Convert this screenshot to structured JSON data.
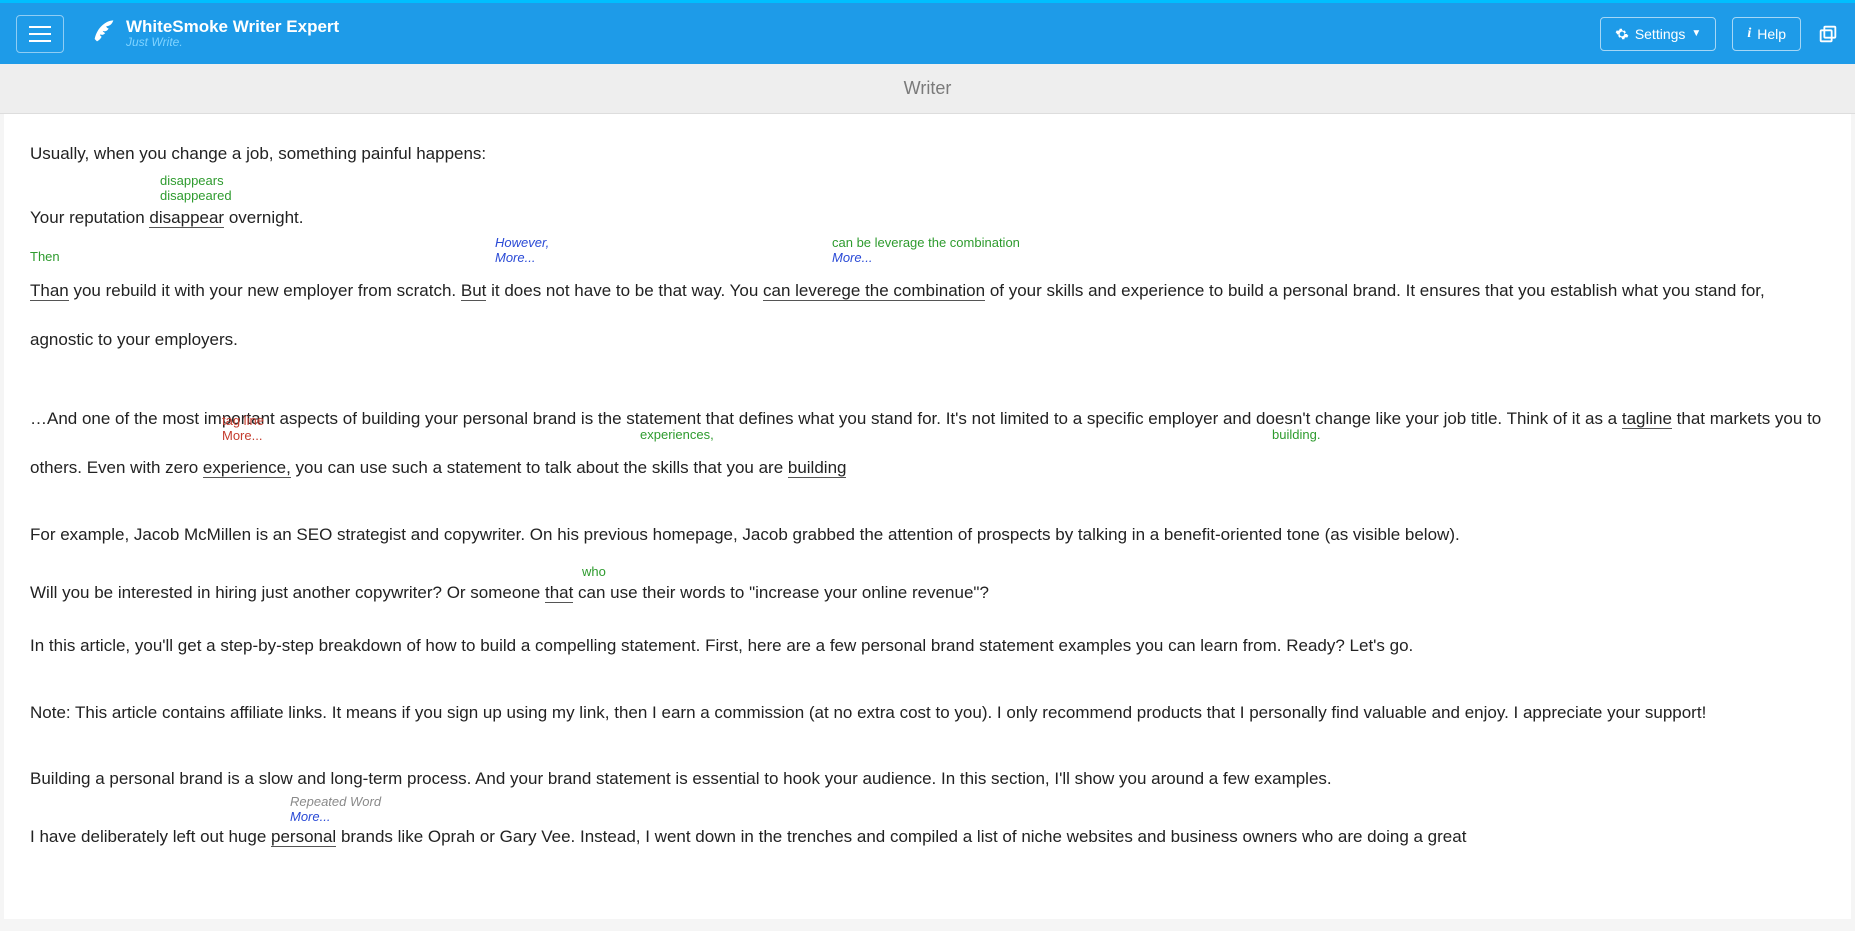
{
  "header": {
    "brand_title": "WhiteSmoke Writer Expert",
    "brand_tagline": "Just Write.",
    "settings_label": "Settings",
    "help_label": "Help"
  },
  "titlebar": {
    "label": "Writer"
  },
  "suggestions": {
    "disappear": {
      "opt1": "disappears",
      "opt2": "disappeared"
    },
    "than": {
      "opt1": "Then"
    },
    "but": {
      "opt1": "However,",
      "more": "More..."
    },
    "leverege": {
      "opt1": "can be leverage the combination",
      "more": "More..."
    },
    "tagline": {
      "opt1": "tag line",
      "more": "More..."
    },
    "experience": {
      "opt1": "experiences,"
    },
    "building": {
      "opt1": "building."
    },
    "that": {
      "opt1": "who"
    },
    "personal": {
      "note": "Repeated Word",
      "more": "More..."
    }
  },
  "text": {
    "p1": "Usually, when you change a job, something painful happens:",
    "p2a": "Your reputation ",
    "p2_err": "disappear",
    "p2b": " overnight.",
    "p3_err1": "Than",
    "p3a": " you rebuild it with your new employer from scratch. ",
    "p3_err2": "But",
    "p3b": " it does not have to be that way. You ",
    "p3_err3": "can leverege the combination",
    "p3c": " of your skills and experience to build a personal brand. It ensures that you establish what you stand for, agnostic to your employers.",
    "p4a": "…And one of the most important aspects of building your personal brand is the statement that defines what you stand for. It's not limited to a specific employer and doesn't change like your job title. Think of it as a ",
    "p4_err1": "tagline",
    "p4b": " that markets you to others. Even with zero ",
    "p4_err2": "experience,",
    "p4c": " you can use such a statement to talk about the skills that you are ",
    "p4_err3": "building",
    "p5": "For example, Jacob McMillen is an SEO strategist and copywriter. On his previous homepage, Jacob grabbed the attention of prospects by talking in a benefit-oriented tone (as visible below).",
    "p6a": "Will you be interested in hiring just another copywriter? Or someone ",
    "p6_err": "that",
    "p6b": " can use their words to \"increase your online revenue\"?",
    "p7": "In this article, you'll get a step-by-step breakdown of how to build a compelling statement. First, here are a few personal brand statement examples you can learn from. Ready? Let's go.",
    "p8": "Note: This article contains affiliate links. It means if you sign up using my link, then I earn a commission (at no extra cost to you). I only recommend products that I personally find valuable and enjoy. I appreciate your support!",
    "p9": "Building a personal brand is a slow and long-term process. And your brand statement is essential to hook your audience. In this section, I'll show you around a few examples.",
    "p10a": "I have deliberately left out huge ",
    "p10_err": "personal",
    "p10b": " brands like Oprah or Gary Vee. Instead, I went down in the trenches and compiled a list of niche websites and business owners who are doing a great"
  }
}
